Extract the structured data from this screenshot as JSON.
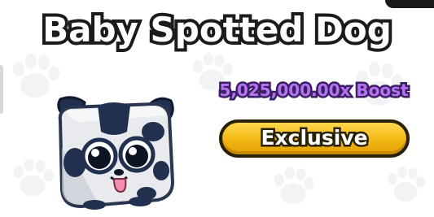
{
  "pet": {
    "name": "Baby  Spotted Dog",
    "boost": "5,025,000.00x Boost",
    "rarity": "Exclusive",
    "image": "baby-spotted-dog-icon"
  },
  "colors": {
    "background": "#ffffff",
    "title_fill": "#ffffff",
    "title_outline": "#1b1b1b",
    "boost_fill": "#b573f2",
    "boost_outline": "#3b1f63",
    "rarity_pill": "#f2b713",
    "rarity_outline": "#2a2104",
    "pet_body": "#e9eaee",
    "pet_spots": "#21304f"
  }
}
